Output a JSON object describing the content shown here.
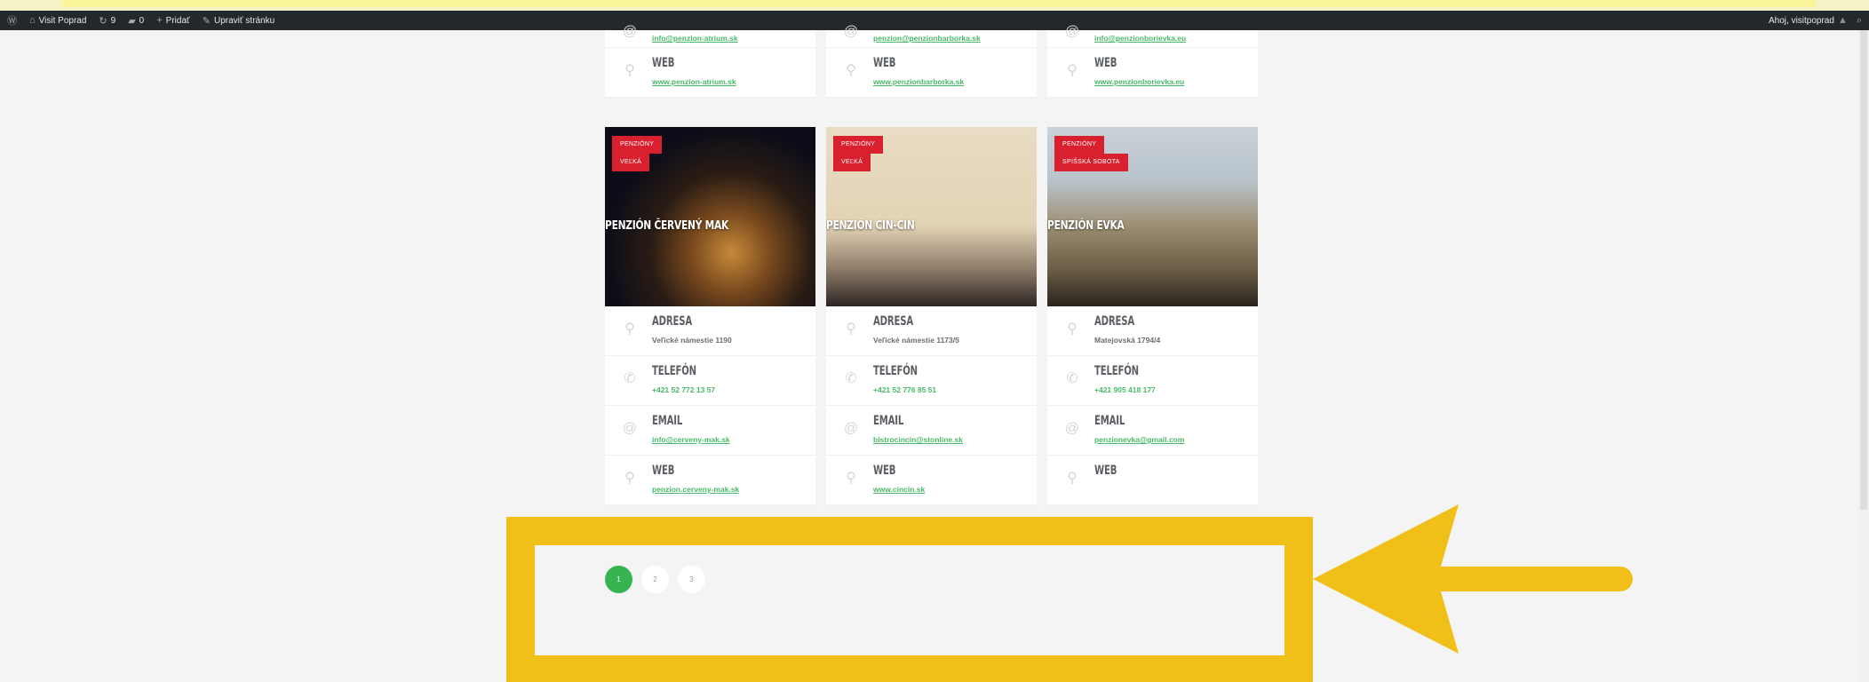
{
  "adminbar": {
    "site_name": "Visit Poprad",
    "updates_count": "9",
    "comments_count": "0",
    "new_label": "Pridať",
    "edit_label": "Upraviť stránku",
    "greeting": "Ahoj, visitpoprad"
  },
  "top_cards": [
    {
      "email": "info@penzion-atrium.sk",
      "web_label": "WEB",
      "web": "www.penzion-atrium.sk"
    },
    {
      "email": "penzion@penzionbarborka.sk",
      "web_label": "WEB",
      "web": "www.penzionbarborka.sk"
    },
    {
      "email": "info@penzionborievka.eu",
      "web_label": "WEB",
      "web": "www.penzionborievka.eu"
    }
  ],
  "cards": [
    {
      "tags": [
        "PENZIÓNY",
        "VEĽKÁ"
      ],
      "title": "PENZIÓN ČERVENÝ MAK",
      "address_label": "ADRESA",
      "address": "Veľické námestie 1190",
      "phone_label": "TELEFÓN",
      "phone": "+421 52 772 13 57",
      "email_label": "EMAIL",
      "email": "info@cerveny-mak.sk",
      "web_label": "WEB",
      "web": "penzion.cerveny-mak.sk"
    },
    {
      "tags": [
        "PENZIÓNY",
        "VEĽKÁ"
      ],
      "title": "PENZIÓN CIN-CIN",
      "address_label": "ADRESA",
      "address": "Veľické námestie 1173/5",
      "phone_label": "TELEFÓN",
      "phone": "+421 52 776 85 51",
      "email_label": "EMAIL",
      "email": "bistrocincin@stonline.sk",
      "web_label": "WEB",
      "web": "www.cincin.sk"
    },
    {
      "tags": [
        "PENZIÓNY",
        "SPIŠSKÁ SOBOTA"
      ],
      "title": "PENZIÓN EVKA",
      "address_label": "ADRESA",
      "address": "Matejovská 1794/4",
      "phone_label": "TELEFÓN",
      "phone": "+421 905 418 177",
      "email_label": "EMAIL",
      "email": "penzionevka@gmail.com",
      "web_label": "WEB",
      "web": ""
    }
  ],
  "pagination": {
    "pages": [
      "1",
      "2",
      "3"
    ],
    "active": "1"
  },
  "colors": {
    "accent_green": "#35b450",
    "tag_red": "#d8202f",
    "highlight_yellow": "#f0c018",
    "adminbar": "#23282d"
  }
}
